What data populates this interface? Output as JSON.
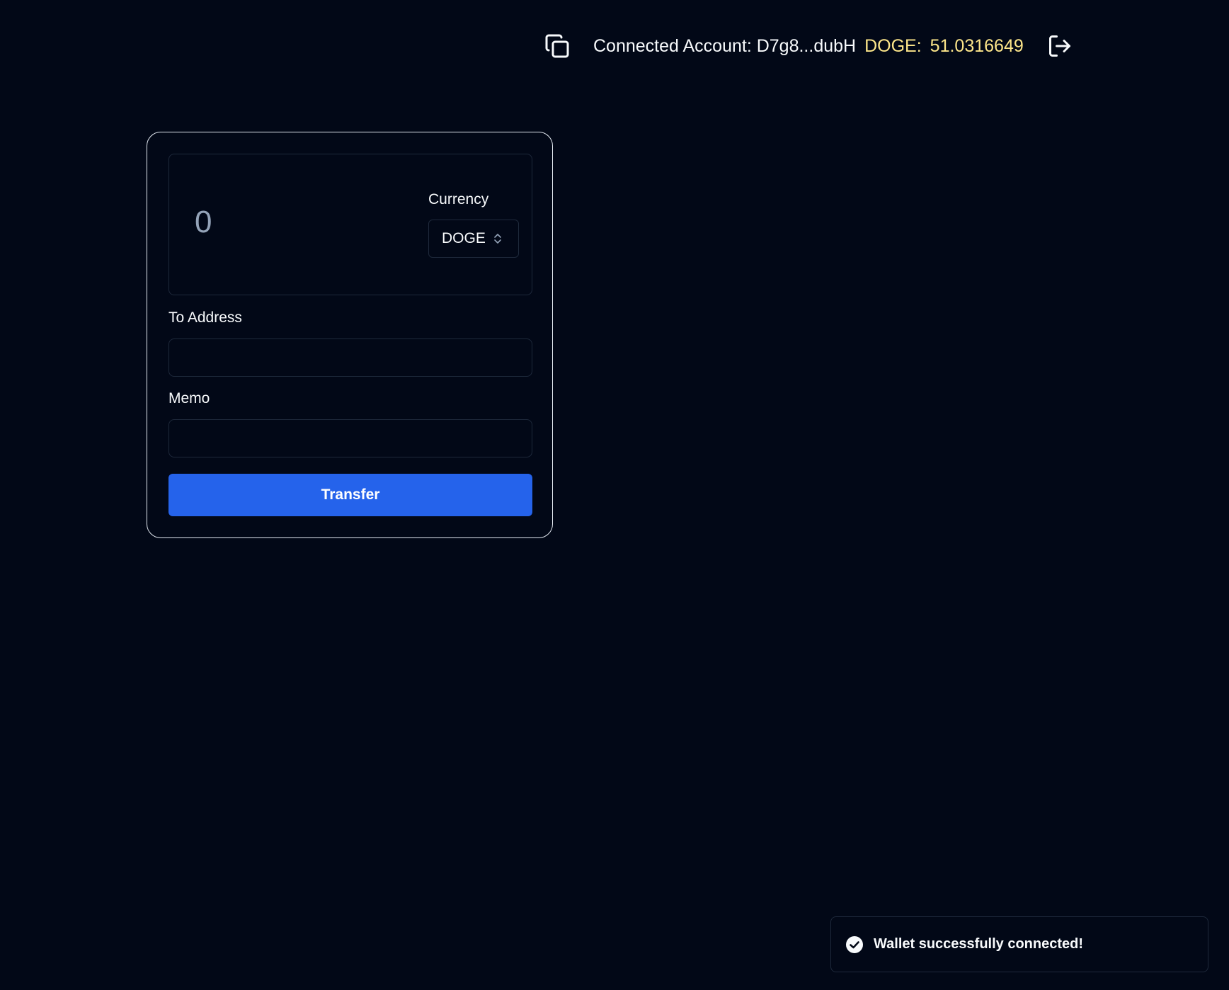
{
  "header": {
    "copy_icon": "copy-icon",
    "account_label": "Connected Account: D7g8...dubH",
    "balance_ticker": "DOGE:",
    "balance_value": "51.0316649",
    "logout_icon": "logout-icon"
  },
  "form": {
    "amount_placeholder": "0",
    "currency_label": "Currency",
    "currency_selected": "DOGE",
    "to_address_label": "To Address",
    "to_address_value": "",
    "memo_label": "Memo",
    "memo_value": "",
    "transfer_label": "Transfer"
  },
  "toast": {
    "icon": "check-circle-icon",
    "message": "Wallet successfully connected!"
  },
  "colors": {
    "background": "#020817",
    "accent": "#2563eb",
    "balance": "#fde68a",
    "border": "#1e293b",
    "card_border": "#e2e8f0"
  }
}
